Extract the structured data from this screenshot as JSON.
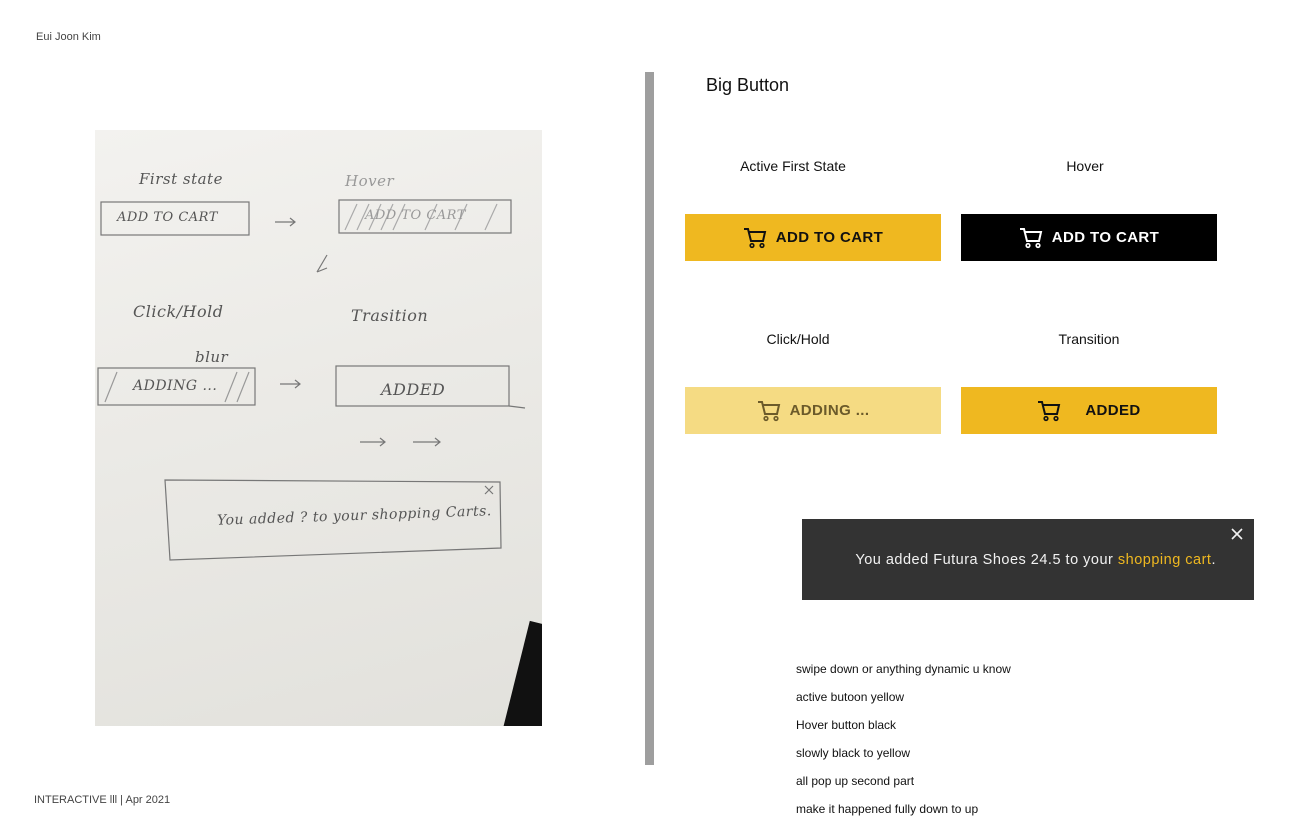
{
  "author": "Eui Joon Kim",
  "footer": "INTERACTIVE lll | Apr 2021",
  "sketch": {
    "first_state": "First state",
    "add_to_cart": "ADD TO CART",
    "hover": "Hover",
    "hover_btn": "ADD TO CART",
    "click_hold": "Click/Hold",
    "blur": "blur",
    "adding": "ADDING ...",
    "transition": "Trasition",
    "added": "ADDED",
    "popup": "You added ? to your shopping Carts."
  },
  "section_title": "Big Button",
  "states": {
    "active_label": "Active First State",
    "hover_label": "Hover",
    "click_label": "Click/Hold",
    "transition_label": "Transition"
  },
  "buttons": {
    "active": "ADD TO CART",
    "hover": "ADD TO CART",
    "adding": "ADDING ...",
    "added": "ADDED"
  },
  "toast": {
    "prefix": "You added Futura Shoes 24.5 to your ",
    "link": "shopping cart",
    "suffix": "."
  },
  "notes": [
    "swipe down or anything dynamic u know",
    "active butoon yellow",
    "Hover button black",
    "slowly black to yellow",
    "all pop up second part",
    "make it happened fully  down to up"
  ],
  "colors": {
    "yellow": "#efb820",
    "light_yellow": "#f5db83",
    "black": "#000000",
    "toast_bg": "#333333"
  }
}
